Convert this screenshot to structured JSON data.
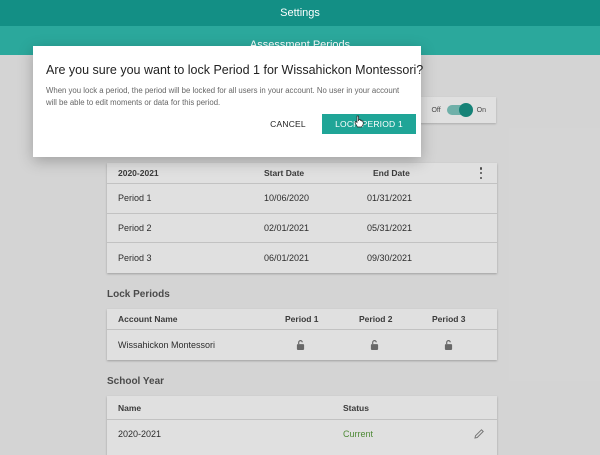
{
  "app": {
    "title": "Settings",
    "subtitle": "Assessment Periods"
  },
  "toggle": {
    "off_label": "Off",
    "on_label": "On",
    "state": "on"
  },
  "periods_table": {
    "headers": [
      "2020-2021",
      "Start Date",
      "End Date"
    ],
    "rows": [
      {
        "name": "Period 1",
        "start": "10/06/2020",
        "end": "01/31/2021"
      },
      {
        "name": "Period 2",
        "start": "02/01/2021",
        "end": "05/31/2021"
      },
      {
        "name": "Period 3",
        "start": "06/01/2021",
        "end": "09/30/2021"
      }
    ]
  },
  "lock_periods": {
    "title": "Lock Periods",
    "headers": [
      "Account Name",
      "Period 1",
      "Period 2",
      "Period 3"
    ],
    "rows": [
      {
        "account": "Wissahickon Montessori"
      }
    ]
  },
  "school_year": {
    "title": "School Year",
    "headers": [
      "Name",
      "Status"
    ],
    "rows": [
      {
        "name": "2020-2021",
        "status": "Current"
      }
    ]
  },
  "dialog": {
    "title": "Are you sure you want to lock Period 1 for Wissahickon Montessori?",
    "body": "When you lock a period, the period will be locked for all users in your account. No user in your account will be able to edit moments or data for this period.",
    "cancel_label": "CANCEL",
    "confirm_label": "LOCK PERIOD 1"
  },
  "colors": {
    "header": "#138f85",
    "subheader": "#2ba89c",
    "primary_button": "#1fa597",
    "status_current": "#5a9e3f"
  }
}
